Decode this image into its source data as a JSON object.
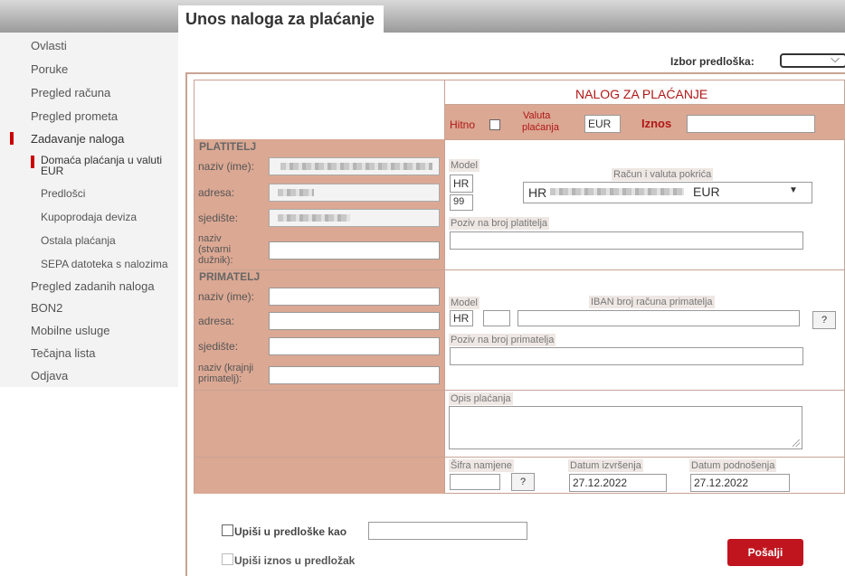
{
  "page": {
    "title": "Unos naloga za plaćanje"
  },
  "sidebar": {
    "items": [
      {
        "label": "Ovlasti"
      },
      {
        "label": "Poruke"
      },
      {
        "label": "Pregled računa"
      },
      {
        "label": "Pregled prometa"
      },
      {
        "label": "Zadavanje naloga",
        "active": true
      },
      {
        "label": "Domaća plaćanja u valuti EUR",
        "active": true
      },
      {
        "label": "Predlošci"
      },
      {
        "label": "Kupoprodaja deviza"
      },
      {
        "label": "Ostala plaćanja"
      },
      {
        "label": "SEPA datoteka s nalozima"
      },
      {
        "label": "Pregled zadanih naloga"
      },
      {
        "label": "BON2"
      },
      {
        "label": "Mobilne usluge"
      },
      {
        "label": "Tečajna lista"
      },
      {
        "label": "Odjava"
      }
    ]
  },
  "template_picker": {
    "label": "Izbor predloška:",
    "selected": ""
  },
  "form": {
    "title": "NALOG ZA PLAĆANJE",
    "hitno_label": "Hitno",
    "valuta_label_1": "Valuta",
    "valuta_label_2": "plaćanja",
    "valuta_value": "EUR",
    "iznos_label": "Iznos",
    "iznos_value": "",
    "platitelj": {
      "heading": "PLATITELJ",
      "naziv_label": "naziv (ime):",
      "adresa_label": "adresa:",
      "sjediste_label": "sjedište:",
      "stvarni_label_1": "naziv",
      "stvarni_label_2": "(stvarni",
      "stvarni_label_3": "dužnik):"
    },
    "payer_account": {
      "model_label": "Model",
      "model_prefix": "HR",
      "model_value": "99",
      "account_label": "Račun i valuta pokrića",
      "account_prefix": "HR",
      "account_currency": "EUR",
      "poziv_label": "Poziv na broj platitelja"
    },
    "primatelj": {
      "heading": "PRIMATELJ",
      "naziv_label": "naziv (ime):",
      "adresa_label": "adresa:",
      "sjediste_label": "sjedište:",
      "krajnji_label_1": "naziv (krajnji",
      "krajnji_label_2": "primatelj):"
    },
    "payee_account": {
      "model_label": "Model",
      "model_prefix": "HR",
      "iban_label": "IBAN broj računa primatelja",
      "help": "?",
      "poziv_label": "Poziv na broj primatelja"
    },
    "opis_label": "Opis plaćanja",
    "sifra_label": "Šifra namjene",
    "sifra_help": "?",
    "datum_izvrsenja_label": "Datum izvršenja",
    "datum_izvrsenja": "27.12.2022",
    "datum_podnosenja_label": "Datum podnošenja",
    "datum_podnosenja": "27.12.2022"
  },
  "bottom": {
    "save_template_label": "Upiši u predloške kao",
    "save_amount_label": "Upiši iznos u predložak",
    "submit_label": "Pošalji"
  },
  "colors": {
    "accent": "#c0151f",
    "band": "#dba893",
    "border": "#c8a393"
  }
}
